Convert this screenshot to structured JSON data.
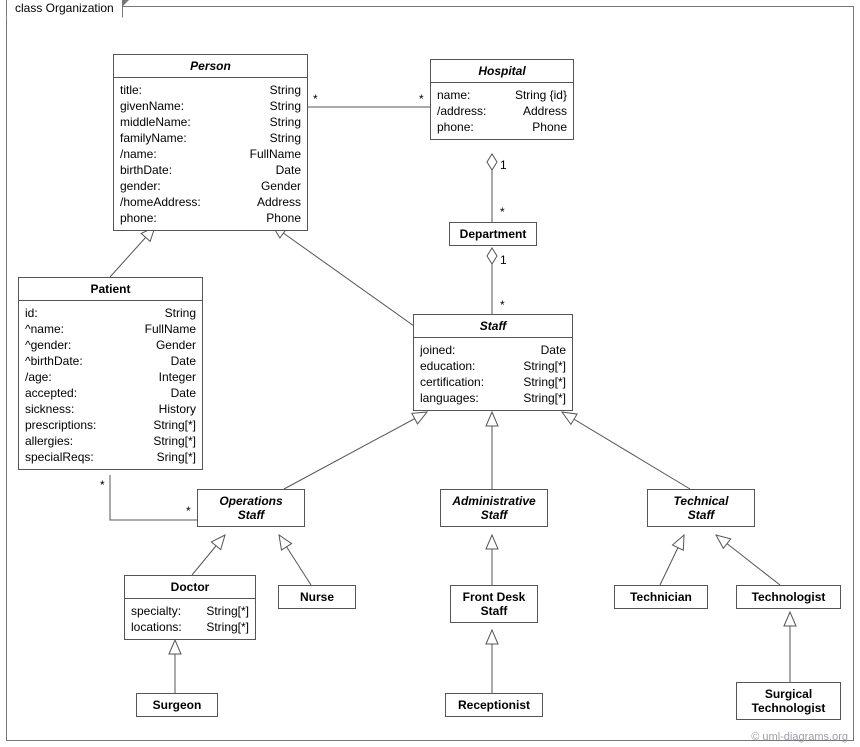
{
  "frame_title": "class Organization",
  "watermark": "© uml-diagrams.org",
  "classes": {
    "person": {
      "title": "Person",
      "attrs": [
        [
          "title:",
          "String"
        ],
        [
          "givenName:",
          "String"
        ],
        [
          "middleName:",
          "String"
        ],
        [
          "familyName:",
          "String"
        ],
        [
          "/name:",
          "FullName"
        ],
        [
          "birthDate:",
          "Date"
        ],
        [
          "gender:",
          "Gender"
        ],
        [
          "/homeAddress:",
          "Address"
        ],
        [
          "phone:",
          "Phone"
        ]
      ]
    },
    "hospital": {
      "title": "Hospital",
      "attrs": [
        [
          "name:",
          "String {id}"
        ],
        [
          "/address:",
          "Address"
        ],
        [
          "phone:",
          "Phone"
        ]
      ]
    },
    "department": {
      "title": "Department"
    },
    "patient": {
      "title": "Patient",
      "attrs": [
        [
          "id:",
          "String"
        ],
        [
          "^name:",
          "FullName"
        ],
        [
          "^gender:",
          "Gender"
        ],
        [
          "^birthDate:",
          "Date"
        ],
        [
          "/age:",
          "Integer"
        ],
        [
          "accepted:",
          "Date"
        ],
        [
          "sickness:",
          "History"
        ],
        [
          "prescriptions:",
          "String[*]"
        ],
        [
          "allergies:",
          "String[*]"
        ],
        [
          "specialReqs:",
          "Sring[*]"
        ]
      ]
    },
    "staff": {
      "title": "Staff",
      "attrs": [
        [
          "joined:",
          "Date"
        ],
        [
          "education:",
          "String[*]"
        ],
        [
          "certification:",
          "String[*]"
        ],
        [
          "languages:",
          "String[*]"
        ]
      ]
    },
    "operations_staff": {
      "title": "Operations\nStaff"
    },
    "administrative_staff": {
      "title": "Administrative\nStaff"
    },
    "technical_staff": {
      "title": "Technical\nStaff"
    },
    "doctor": {
      "title": "Doctor",
      "attrs": [
        [
          "specialty:",
          "String[*]"
        ],
        [
          "locations:",
          "String[*]"
        ]
      ]
    },
    "nurse": {
      "title": "Nurse"
    },
    "front_desk": {
      "title": "Front Desk\nStaff"
    },
    "receptionist": {
      "title": "Receptionist"
    },
    "surgeon": {
      "title": "Surgeon"
    },
    "technician": {
      "title": "Technician"
    },
    "technologist": {
      "title": "Technologist"
    },
    "surgical_technologist": {
      "title": "Surgical\nTechnologist"
    }
  },
  "mult": {
    "person_hospital_left": "*",
    "person_hospital_right": "*",
    "hospital_dept_top": "1",
    "hospital_dept_bottom": "*",
    "dept_staff_top": "1",
    "dept_staff_bottom": "*",
    "patient_ops_left": "*",
    "patient_ops_right": "*"
  }
}
